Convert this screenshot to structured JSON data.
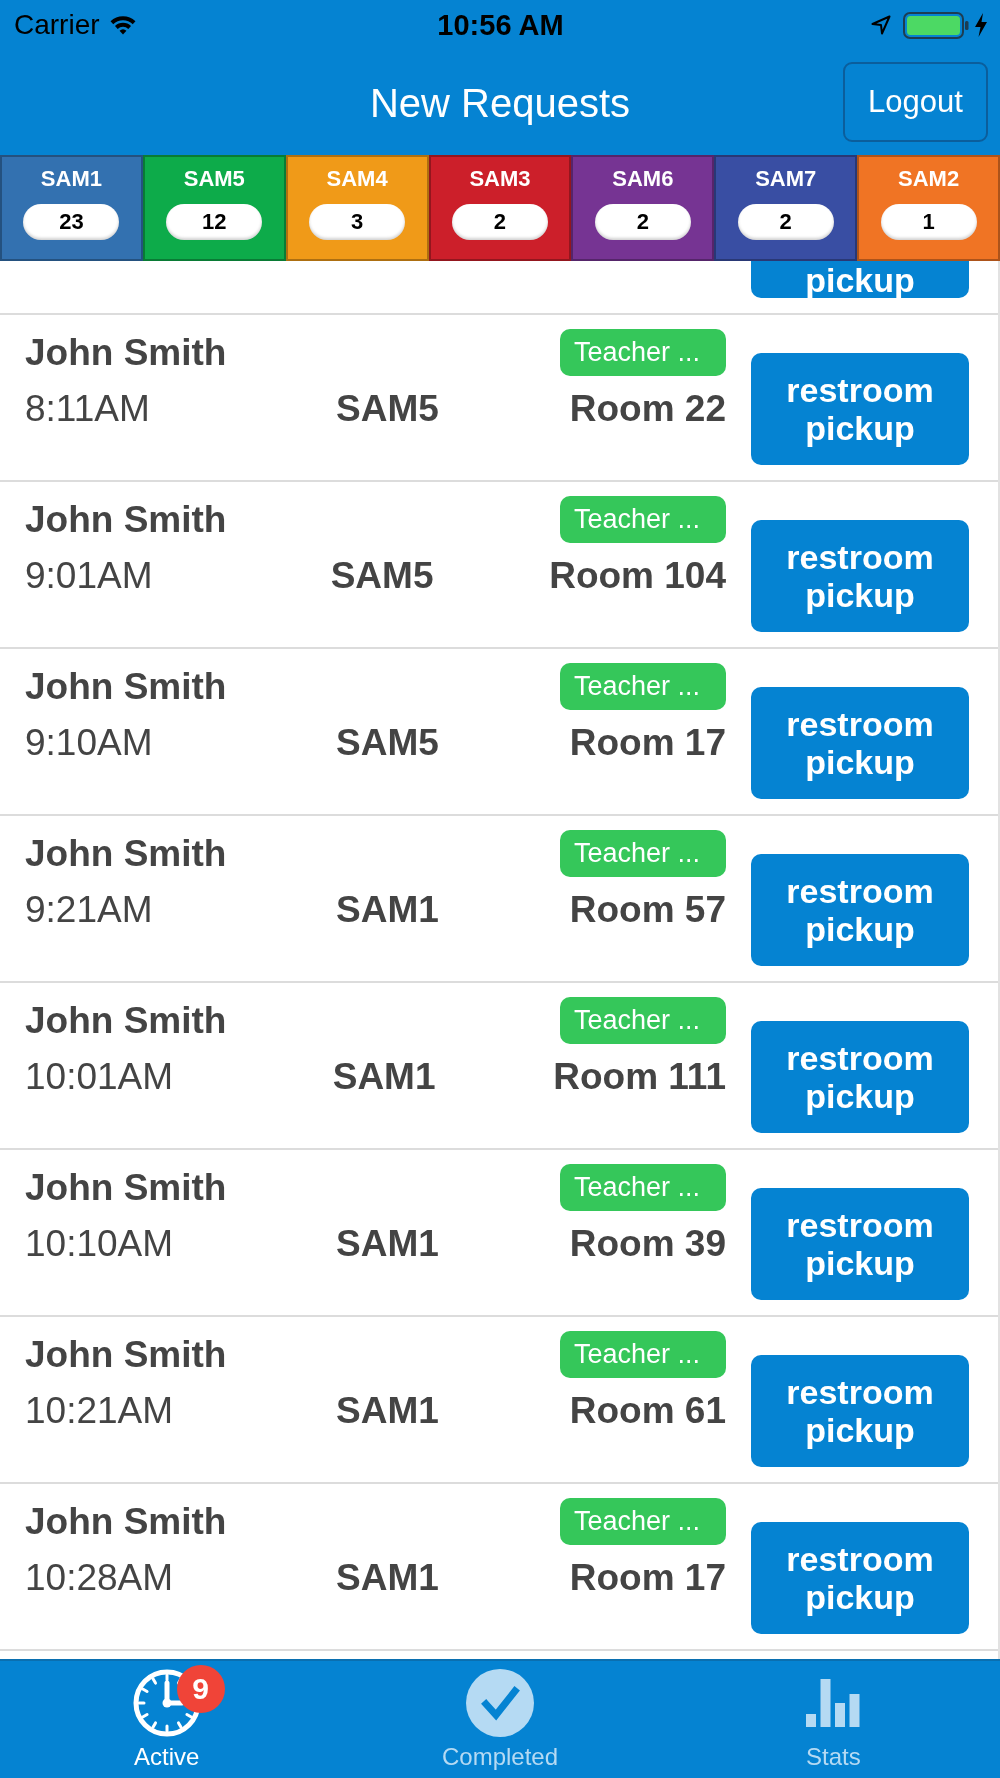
{
  "status_bar": {
    "carrier": "Carrier",
    "time": "10:56 AM"
  },
  "header": {
    "title": "New Requests",
    "logout": "Logout"
  },
  "sam_filters": [
    {
      "label": "SAM1",
      "count": "23",
      "color": "#3371b0"
    },
    {
      "label": "SAM5",
      "count": "12",
      "color": "#0dab4a"
    },
    {
      "label": "SAM4",
      "count": "3",
      "color": "#f09a18"
    },
    {
      "label": "SAM3",
      "count": "2",
      "color": "#cc1f2a"
    },
    {
      "label": "SAM6",
      "count": "2",
      "color": "#763493"
    },
    {
      "label": "SAM7",
      "count": "2",
      "color": "#394ea3"
    },
    {
      "label": "SAM2",
      "count": "1",
      "color": "#f07424"
    }
  ],
  "clipped_request": {
    "action": "pickup"
  },
  "requests": [
    {
      "name": "John Smith",
      "time": "8:11AM",
      "sam": "SAM5",
      "tag": "Teacher ...",
      "room": "Room 22",
      "action": "restroom pickup"
    },
    {
      "name": "John Smith",
      "time": "9:01AM",
      "sam": "SAM5",
      "tag": "Teacher ...",
      "room": "Room 104",
      "action": "restroom pickup"
    },
    {
      "name": "John Smith",
      "time": "9:10AM",
      "sam": "SAM5",
      "tag": "Teacher ...",
      "room": "Room 17",
      "action": "restroom pickup"
    },
    {
      "name": "John Smith",
      "time": "9:21AM",
      "sam": "SAM1",
      "tag": "Teacher ...",
      "room": "Room 57",
      "action": "restroom pickup"
    },
    {
      "name": "John Smith",
      "time": "10:01AM",
      "sam": "SAM1",
      "tag": "Teacher ...",
      "room": "Room 111",
      "action": "restroom pickup"
    },
    {
      "name": "John Smith",
      "time": "10:10AM",
      "sam": "SAM1",
      "tag": "Teacher ...",
      "room": "Room 39",
      "action": "restroom pickup"
    },
    {
      "name": "John Smith",
      "time": "10:21AM",
      "sam": "SAM1",
      "tag": "Teacher ...",
      "room": "Room 61",
      "action": "restroom pickup"
    },
    {
      "name": "John Smith",
      "time": "10:28AM",
      "sam": "SAM1",
      "tag": "Teacher ...",
      "room": "Room 17",
      "action": "restroom pickup"
    }
  ],
  "tab_bar": {
    "tabs": [
      {
        "label": "Active",
        "selected": true,
        "badge": "9"
      },
      {
        "label": "Completed",
        "selected": false
      },
      {
        "label": "Stats",
        "selected": false
      }
    ]
  }
}
